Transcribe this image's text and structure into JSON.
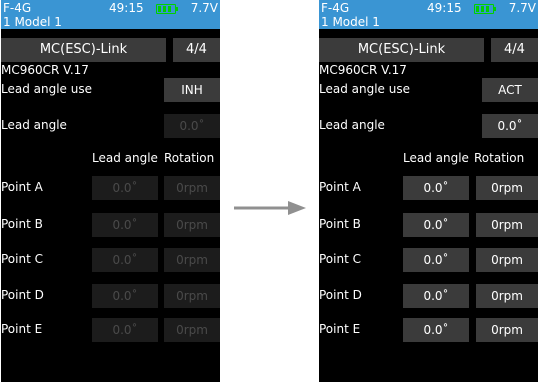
{
  "screens": [
    {
      "status": {
        "model_id": "F-4G",
        "time": "49:15",
        "voltage": "7.7V",
        "model_name": "1   Model 1",
        "battery_color": "#00d000"
      },
      "link_button": "MC(ESC)-Link",
      "page": "4/4",
      "firmware": "MC960CR V.17",
      "lead_angle_use_label": "Lead angle use",
      "lead_angle_use_value": "INH",
      "lead_angle_label": "Lead angle",
      "lead_angle_value": "0.0˚",
      "col_lead_angle": "Lead angle",
      "col_rotation": "Rotation",
      "points": [
        {
          "label": "Point A",
          "angle": "0.0˚",
          "rotation": "0rpm"
        },
        {
          "label": "Point B",
          "angle": "0.0˚",
          "rotation": "0rpm"
        },
        {
          "label": "Point C",
          "angle": "0.0˚",
          "rotation": "0rpm"
        },
        {
          "label": "Point D",
          "angle": "0.0˚",
          "rotation": "0rpm"
        },
        {
          "label": "Point E",
          "angle": "0.0˚",
          "rotation": "0rpm"
        }
      ],
      "fields_enabled": false
    },
    {
      "status": {
        "model_id": "F-4G",
        "time": "49:15",
        "voltage": "7.7V",
        "model_name": "1   Model 1",
        "battery_color": "#00d000"
      },
      "link_button": "MC(ESC)-Link",
      "page": "4/4",
      "firmware": "MC960CR V.17",
      "lead_angle_use_label": "Lead angle use",
      "lead_angle_use_value": "ACT",
      "lead_angle_label": "Lead angle",
      "lead_angle_value": "0.0˚",
      "col_lead_angle": "Lead angle",
      "col_rotation": "Rotation",
      "points": [
        {
          "label": "Point A",
          "angle": "0.0˚",
          "rotation": "0rpm"
        },
        {
          "label": "Point B",
          "angle": "0.0˚",
          "rotation": "0rpm"
        },
        {
          "label": "Point C",
          "angle": "0.0˚",
          "rotation": "0rpm"
        },
        {
          "label": "Point D",
          "angle": "0.0˚",
          "rotation": "0rpm"
        },
        {
          "label": "Point E",
          "angle": "0.0˚",
          "rotation": "0rpm"
        }
      ],
      "fields_enabled": true
    }
  ],
  "colors": {
    "status_bar": "#3a95d3",
    "field_active": "#3b3b3b",
    "field_disabled": "#1c1c1c",
    "arrow": "#909090"
  },
  "arrow_icon": "arrow-right-icon"
}
